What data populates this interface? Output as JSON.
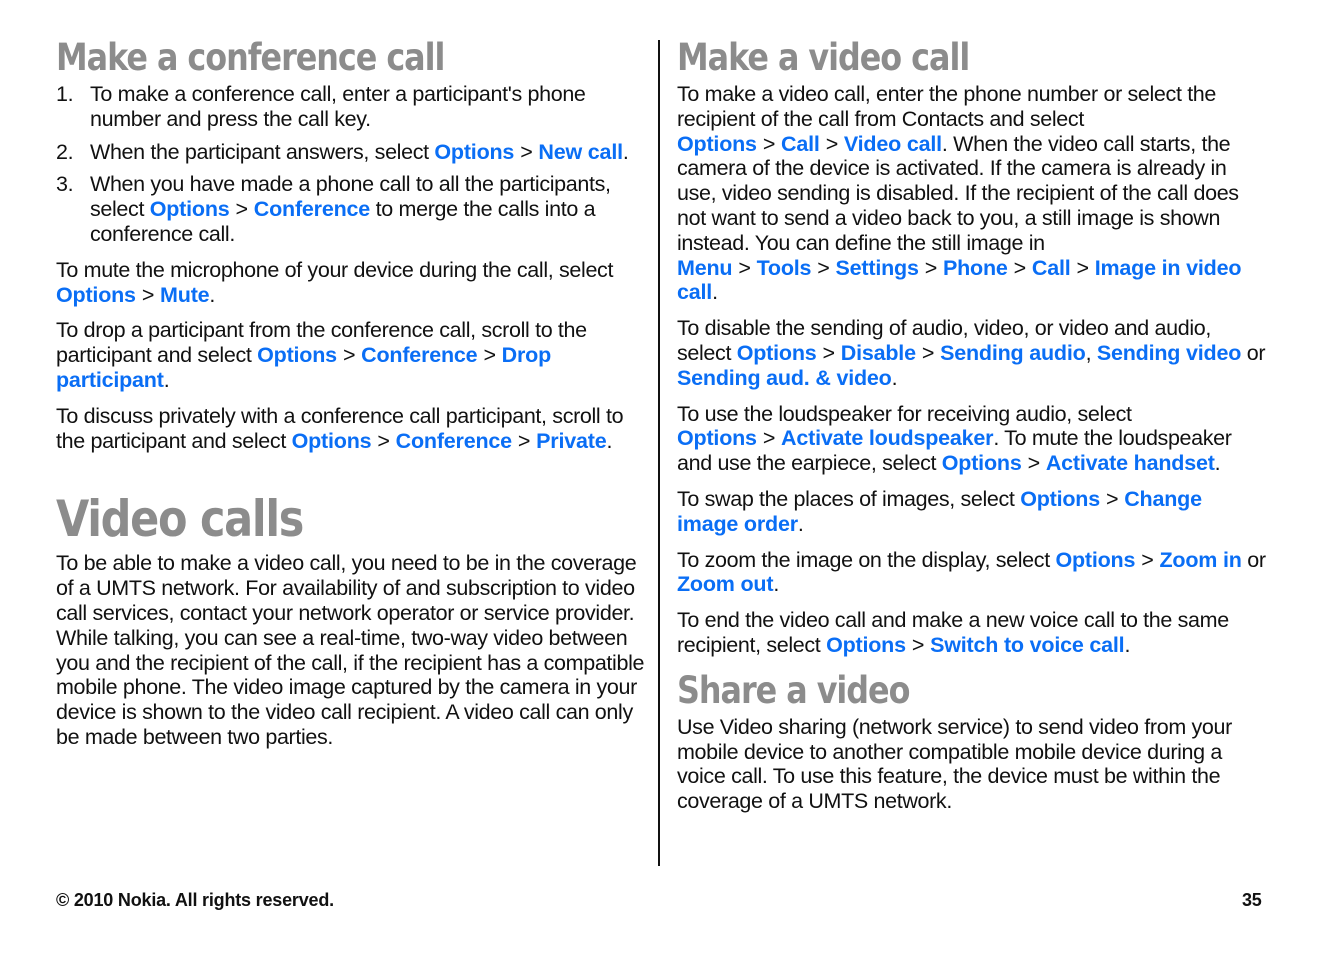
{
  "left": {
    "conference": {
      "title": "Make a conference call",
      "steps": [
        {
          "num": "1.",
          "text": "To make a conference call, enter a participant's phone number and press the call key."
        },
        {
          "num": "2.",
          "pre": "When the participant answers, select ",
          "l1": "Options",
          "l2": "New call",
          "post": "."
        },
        {
          "num": "3.",
          "pre": "When you have made a phone call to all the participants, select ",
          "l1": "Options",
          "l2": "Conference",
          "post": " to merge the calls into a conference call."
        }
      ],
      "mute": {
        "pre": "To mute the microphone of your device during the call, select ",
        "l1": "Options",
        "l2": "Mute",
        "post": "."
      },
      "drop": {
        "pre": "To drop a participant from the conference call, scroll to the participant and select ",
        "l1": "Options",
        "l2": "Conference",
        "l3": "Drop participant",
        "post": "."
      },
      "private": {
        "pre": "To discuss privately with a conference call participant, scroll to the participant and select ",
        "l1": "Options",
        "l2": "Conference",
        "l3": "Private",
        "post": "."
      }
    },
    "video_calls": {
      "title": "Video calls",
      "body": "To be able to make a video call, you need to be in the coverage of a UMTS network. For availability of and subscription to video call services, contact your network operator or service provider. While talking, you can see a real-time, two-way video between you and the recipient of the call, if the recipient has a compatible mobile phone. The video image captured by the camera in your device is shown to the video call recipient. A video call can only be made between two parties."
    }
  },
  "right": {
    "make_video": {
      "title": "Make a video call",
      "p1": {
        "pre": "To make a video call, enter the phone number or select the recipient of the call from Contacts and select ",
        "l1": "Options",
        "l2": "Call",
        "l3": "Video call",
        "mid": ". When the video call starts, the camera of the device is activated. If the camera is already in use, video sending is disabled. If the recipient of the call does not want to send a video back to you, a still image is shown instead. You can define the still image in ",
        "m1": "Menu",
        "m2": "Tools",
        "m3": "Settings",
        "m4": "Phone",
        "m5": "Call",
        "m6": "Image in video call",
        "post": "."
      },
      "p2": {
        "pre": "To disable the sending of audio, video, or video and audio, select ",
        "l1": "Options",
        "l2": "Disable",
        "l3": "Sending audio",
        "sep": ", ",
        "l4": "Sending video",
        "or": " or ",
        "l5": "Sending aud. & video",
        "post": "."
      },
      "p3": {
        "pre": "To use the loudspeaker for receiving audio, select ",
        "l1": "Options",
        "l2": "Activate loudspeaker",
        "mid": ". To mute the loudspeaker and use the earpiece, select ",
        "l3": "Options",
        "l4": "Activate handset",
        "post": "."
      },
      "p4": {
        "pre": "To swap the places of images, select ",
        "l1": "Options",
        "l2": "Change image order",
        "post": "."
      },
      "p5": {
        "pre": "To zoom the image on the display, select ",
        "l1": "Options",
        "l2": "Zoom in",
        "or": " or ",
        "l3": "Zoom out",
        "post": "."
      },
      "p6": {
        "pre": "To end the video call and make a new voice call to the same recipient, select ",
        "l1": "Options",
        "l2": "Switch to voice call",
        "post": "."
      }
    },
    "share": {
      "title": "Share a video",
      "body": "Use Video sharing (network service) to send video from your mobile device to another compatible mobile device during a voice call. To use this feature, the device must be within the coverage of a UMTS network."
    }
  },
  "sep": ">",
  "footer": {
    "copyright": "© 2010 Nokia. All rights reserved.",
    "page": "35"
  },
  "colors": {
    "link": "#0a6ef5",
    "heading": "#8c8c8c",
    "text": "#111111"
  }
}
